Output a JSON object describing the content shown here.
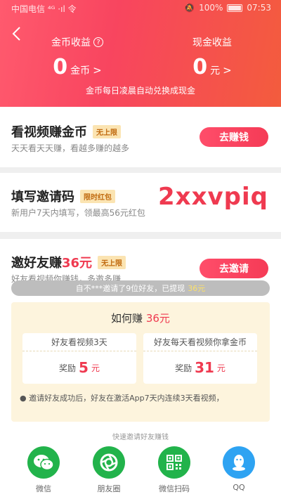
{
  "status_bar": {
    "carrier": "中国电信 ⁴ᴳ ·ıl 令",
    "battery": "100%",
    "time": "07:53"
  },
  "header": {
    "coin_label": "金币收益",
    "coin_value": "0",
    "coin_unit": "金币",
    "cash_label": "现金收益",
    "cash_value": "0",
    "cash_unit": "元",
    "note": "金币每日凌晨自动兑换成现金",
    "chevron": ">",
    "help": "?"
  },
  "watch": {
    "title": "看视频赚金币",
    "tag": "无上限",
    "subtitle": "天天看天天赚，看越多赚的越多",
    "button": "去赚钱"
  },
  "code_card": {
    "title": "填写邀请码",
    "tag": "限时红包",
    "subtitle": "新用户7天内填写，领最高56元红包",
    "code": "2xxvpiq"
  },
  "invite": {
    "title": "邀好友赚",
    "amount": "36元",
    "tag": "无上限",
    "subtitle": "好友看视频你赚钱，多邀多赚",
    "button": "去邀请",
    "ticker_a": "自不***邀请了9位好友，已提现",
    "ticker_b": "36元",
    "how_title": "如何赚",
    "how_amount": "36元",
    "card1_title": "好友看视频3天",
    "card1_reward_label": "奖励",
    "card1_reward_value": "5",
    "card1_reward_unit": "元",
    "card2_title": "好友每天看视频你拿金币",
    "card2_reward_label": "奖励",
    "card2_reward_value": "31",
    "card2_reward_unit": "元",
    "bullet": "● 邀请好友成功后，好友在激活App7天内连续3天看视频，"
  },
  "share": {
    "title": "快速邀请好友赚钱",
    "items": [
      {
        "label": "微信",
        "color": "#22b34b"
      },
      {
        "label": "朋友圈",
        "color": "#22b34b"
      },
      {
        "label": "微信扫码",
        "color": "#22b34b"
      },
      {
        "label": "QQ",
        "color": "#2ea3f2"
      }
    ]
  }
}
